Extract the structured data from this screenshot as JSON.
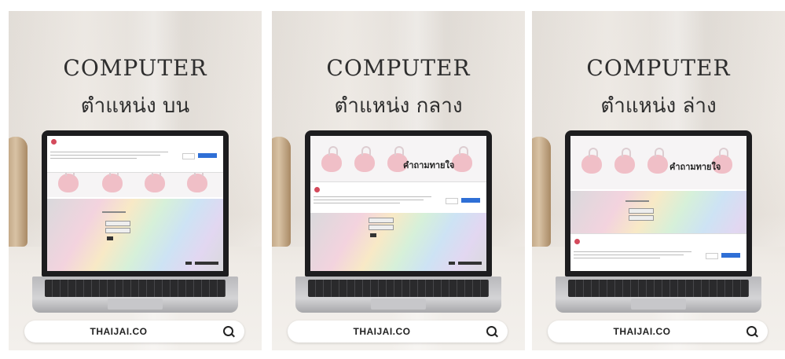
{
  "panels": [
    {
      "title": "COMPUTER",
      "subtitle": "ตำแหน่ง บน",
      "search_text": "THAIJAI.CO",
      "banner_position": "top"
    },
    {
      "title": "COMPUTER",
      "subtitle": "ตำแหน่ง กลาง",
      "search_text": "THAIJAI.CO",
      "banner_position": "middle",
      "site_title": "คำถามทายใจ"
    },
    {
      "title": "COMPUTER",
      "subtitle": "ตำแหน่ง ล่าง",
      "search_text": "THAIJAI.CO",
      "banner_position": "bottom",
      "site_title": "คำถามทายใจ"
    }
  ],
  "icons": {
    "search": "search-icon"
  }
}
